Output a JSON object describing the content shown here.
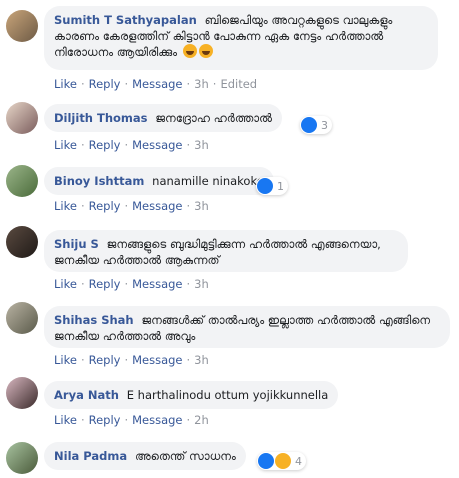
{
  "actions": {
    "like": "Like",
    "reply": "Reply",
    "message": "Message",
    "separator": "·"
  },
  "colors": {
    "link": "#385898",
    "muted": "#90949c",
    "bubble": "#f2f3f5",
    "like_blue": "#1877f2"
  },
  "comments": [
    {
      "author": "Sumith T Sathyapalan",
      "text": "ബിജെപിയും അവറ്റകളുടെ വാലുകളും കാരണം കേരളത്തിന് കിട്ടാൻ പോകുന്ന ഏക നേട്ടം ഹർത്താൽ നിരോധനം ആയിരിക്കും",
      "emojis": [
        "laughing-emoji",
        "laughing-emoji"
      ],
      "time": "3h",
      "edited": "Edited",
      "reactions": null
    },
    {
      "author": "Diljith Thomas",
      "text": "ജനദ്രോഹ ഹർത്താൽ",
      "time": "3h",
      "reactions": {
        "icons": [
          "like-icon"
        ],
        "count": "3"
      }
    },
    {
      "author": "Binoy Ishttam",
      "text": "nanamille ninakoke",
      "time": "3h",
      "reactions": {
        "icons": [
          "like-icon"
        ],
        "count": "1"
      }
    },
    {
      "author": "Shiju S",
      "text": "ജനങ്ങളുടെ ബുദ്ധിമുട്ടിക്കുന്ന ഹർത്താൽ എങ്ങനെയാ, ജനകീയ ഹർത്താൽ ആകുന്നത്",
      "time": "3h",
      "reactions": null
    },
    {
      "author": "Shihas Shah",
      "text": "ജനങ്ങൾക്ക് താൽപര്യം ഇല്ലാത്ത ഹർത്താൽ എങ്ങിനെ ജനകീയ ഹർത്താൽ അവും",
      "time": "3h",
      "reactions": null
    },
    {
      "author": "Arya Nath",
      "text": "E harthalinodu ottum yojikkunnella",
      "time": "2h",
      "reactions": null
    },
    {
      "author": "Nila Padma",
      "text": "അതെന്ത് സാധനം",
      "time": "",
      "reactions": {
        "icons": [
          "like-icon",
          "haha-icon"
        ],
        "count": "4"
      }
    }
  ]
}
